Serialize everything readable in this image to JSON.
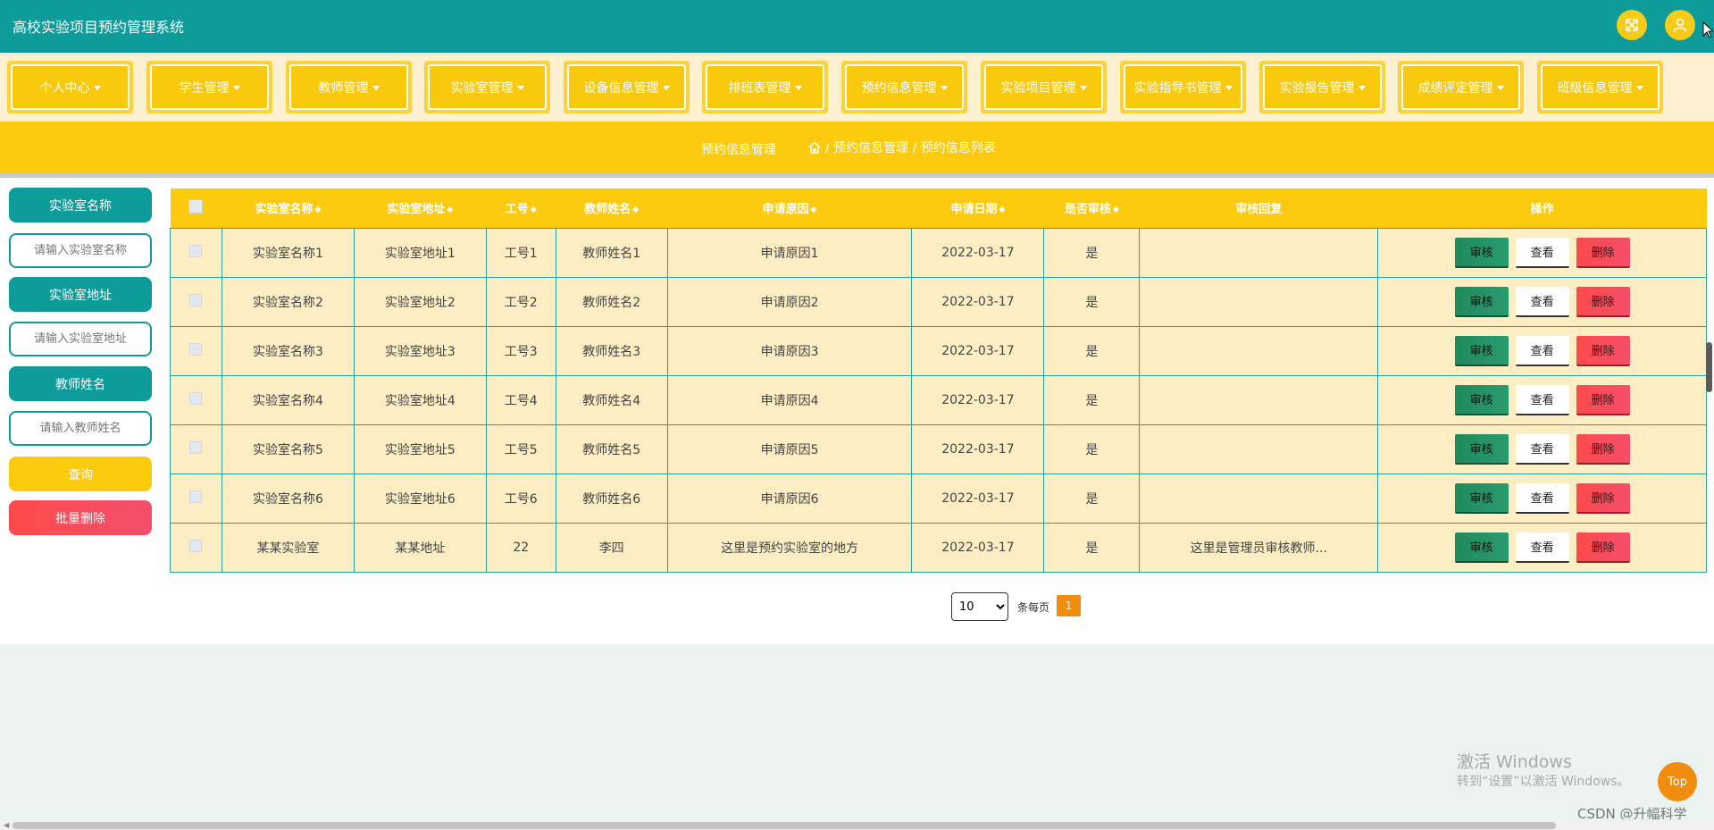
{
  "app": {
    "title": "高校实验项目预约管理系统"
  },
  "header": {
    "icons": [
      "expand-icon",
      "user-icon"
    ]
  },
  "nav": [
    {
      "label": "个人中心"
    },
    {
      "label": "学生管理"
    },
    {
      "label": "教师管理"
    },
    {
      "label": "实验室管理"
    },
    {
      "label": "设备信息管理"
    },
    {
      "label": "排班表管理"
    },
    {
      "label": "预约信息管理"
    },
    {
      "label": "实验项目管理"
    },
    {
      "label": "实验指导书管理"
    },
    {
      "label": "实验报告管理"
    },
    {
      "label": "成绩评定管理"
    },
    {
      "label": "班级信息管理"
    }
  ],
  "breadcrumb": {
    "section": "预约信息管理",
    "path": "/ 预约信息管理 / 预约信息列表"
  },
  "search": {
    "lab_name_label": "实验室名称",
    "lab_name_placeholder": "请输入实验室名称",
    "lab_addr_label": "实验室地址",
    "lab_addr_placeholder": "请输入实验室地址",
    "teacher_label": "教师姓名",
    "teacher_placeholder": "请输入教师姓名",
    "query_label": "查询",
    "batch_delete_label": "批量删除"
  },
  "table": {
    "columns": [
      "实验室名称",
      "实验室地址",
      "工号",
      "教师姓名",
      "申请原因",
      "申请日期",
      "是否审核",
      "审核回复",
      "操作"
    ],
    "actions": {
      "audit": "审核",
      "view": "查看",
      "delete": "删除"
    },
    "rows": [
      [
        "实验室名称1",
        "实验室地址1",
        "工号1",
        "教师姓名1",
        "申请原因1",
        "2022-03-17",
        "是",
        ""
      ],
      [
        "实验室名称2",
        "实验室地址2",
        "工号2",
        "教师姓名2",
        "申请原因2",
        "2022-03-17",
        "是",
        ""
      ],
      [
        "实验室名称3",
        "实验室地址3",
        "工号3",
        "教师姓名3",
        "申请原因3",
        "2022-03-17",
        "是",
        ""
      ],
      [
        "实验室名称4",
        "实验室地址4",
        "工号4",
        "教师姓名4",
        "申请原因4",
        "2022-03-17",
        "是",
        ""
      ],
      [
        "实验室名称5",
        "实验室地址5",
        "工号5",
        "教师姓名5",
        "申请原因5",
        "2022-03-17",
        "是",
        ""
      ],
      [
        "实验室名称6",
        "实验室地址6",
        "工号6",
        "教师姓名6",
        "申请原因6",
        "2022-03-17",
        "是",
        ""
      ],
      [
        "某某实验室",
        "某某地址",
        "22",
        "李四",
        "这里是预约实验室的地方",
        "2022-03-17",
        "是",
        "这里是管理员审核教师..."
      ]
    ]
  },
  "pager": {
    "page_size": "10",
    "per_page_text": "条每页",
    "current_page": "1"
  },
  "watermark": {
    "line1": "激活 Windows",
    "line2": "转到“设置”以激活 Windows。"
  },
  "top_button": "Top",
  "csdn": "CSDN @升幅科学",
  "colors": {
    "primary": "#0e9c9a",
    "accent": "#fdcb0e",
    "danger": "#fe4a4a",
    "orange": "#f08c0e"
  }
}
